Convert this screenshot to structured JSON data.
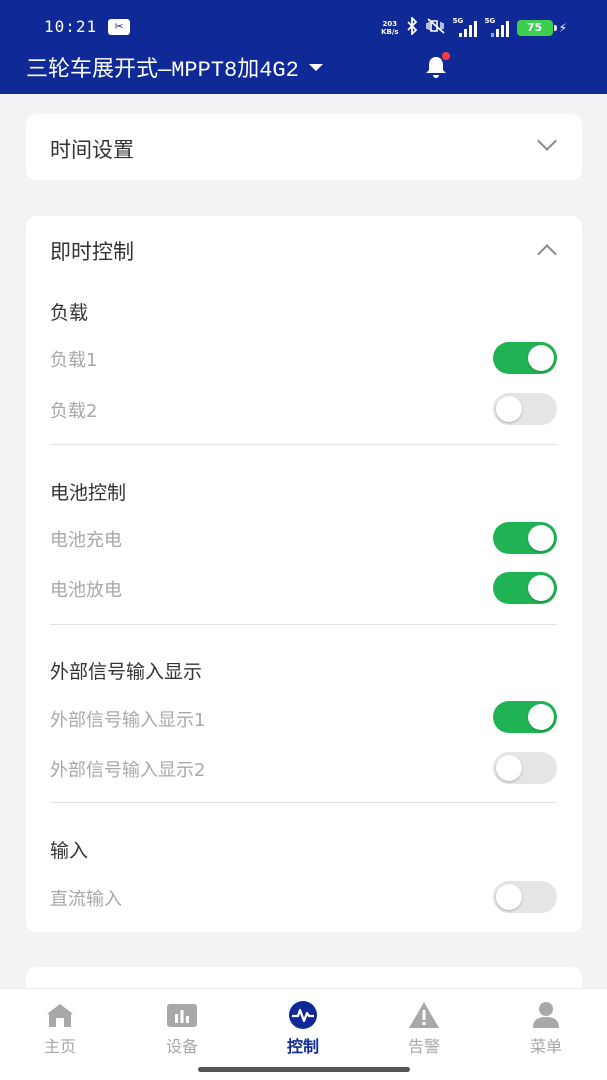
{
  "statusbar": {
    "time": "10:21",
    "netspeed_value": "203",
    "netspeed_unit": "KB/s",
    "sig1_label": "5G",
    "sig2_label": "5G",
    "battery": "75"
  },
  "header": {
    "title": "三轮车展开式—MPPT8加4G2"
  },
  "time_settings": {
    "title": "时间设置"
  },
  "instant_control": {
    "title": "即时控制",
    "sections": [
      {
        "title": "负载",
        "rows": [
          {
            "label": "负载1",
            "on": true
          },
          {
            "label": "负载2",
            "on": false
          }
        ]
      },
      {
        "title": "电池控制",
        "rows": [
          {
            "label": "电池充电",
            "on": true
          },
          {
            "label": "电池放电",
            "on": true
          }
        ]
      },
      {
        "title": "外部信号输入显示",
        "rows": [
          {
            "label": "外部信号输入显示1",
            "on": true
          },
          {
            "label": "外部信号输入显示2",
            "on": false
          }
        ]
      },
      {
        "title": "输入",
        "rows": [
          {
            "label": "直流输入",
            "on": false
          }
        ]
      }
    ]
  },
  "tabbar": {
    "tabs": [
      {
        "label": "主页",
        "icon": "home-icon",
        "active": false
      },
      {
        "label": "设备",
        "icon": "device-icon",
        "active": false
      },
      {
        "label": "控制",
        "icon": "control-icon",
        "active": true
      },
      {
        "label": "告警",
        "icon": "alarm-icon",
        "active": false
      },
      {
        "label": "菜单",
        "icon": "user-menu-icon",
        "active": false
      }
    ]
  },
  "colors": {
    "header_bg": "#0f2a97",
    "toggle_on": "#1fb354",
    "active_tab": "#0f2a97",
    "notification_dot": "#ff3b3b"
  }
}
